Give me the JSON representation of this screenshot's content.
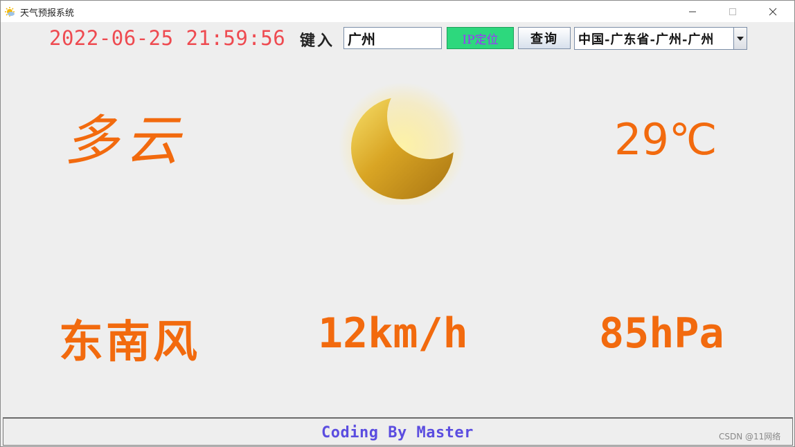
{
  "window": {
    "title": "天气预报系统"
  },
  "toolbar": {
    "datetime": "2022-06-25 21:59:56",
    "input_label": "键入",
    "city_value": "广州",
    "ip_button_label": "IP定位",
    "query_button_label": "查询",
    "region_selected": "中国-广东省-广州-广州"
  },
  "weather": {
    "condition": "多云",
    "icon": "moon-icon",
    "temperature": "29℃",
    "wind_direction": "东南风",
    "wind_speed": "12km/h",
    "pressure": "85hPa"
  },
  "footer": {
    "credit": "Coding By Master"
  },
  "watermark": "CSDN @11网络",
  "colors": {
    "accent_orange": "#f26a0e",
    "clock_red": "#ee4a50",
    "ip_button_green": "#2dd87d",
    "ip_button_text": "#a030ff",
    "footer_text": "#5b4de0"
  }
}
